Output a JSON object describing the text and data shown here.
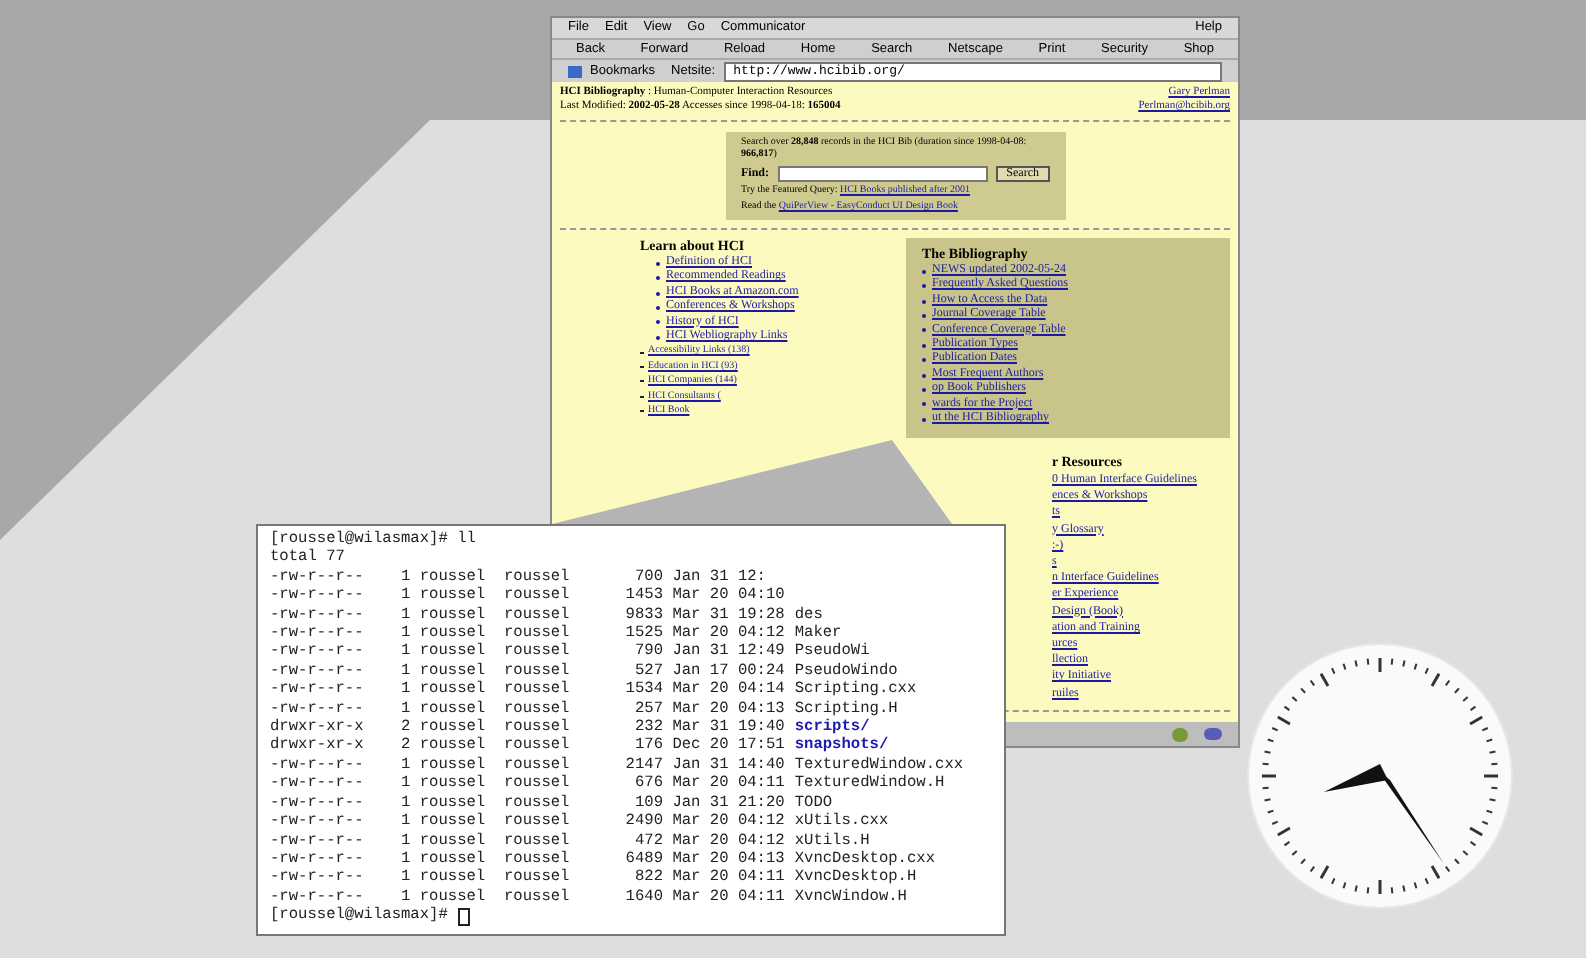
{
  "browser": {
    "menu": [
      "File",
      "Edit",
      "View",
      "Go",
      "Communicator"
    ],
    "help_menu": "Help",
    "toolbar": [
      "Back",
      "Forward",
      "Reload",
      "Home",
      "Search",
      "Netscape",
      "Print",
      "Security",
      "Shop"
    ],
    "bookmarks": "Bookmarks",
    "netsite_label": "Netsite:",
    "url": "http://www.hcibib.org/",
    "page": {
      "title": "**HCI Bibliography** : Human-Computer Interaction Resources",
      "modified": "Last Modified: **2002-05-28** Accesses since 1998-04-18: **165004**",
      "author": "Gary Perlman",
      "email": "Perlman@hcibib.org",
      "search_note": "Search over **28,848** records in the HCI Bib (duration since 1998-04-08: **966,817**)",
      "find_label": "Find:",
      "search_button": "Search",
      "featured": [
        {
          "text": "Try the Featured Query:",
          "link": "HCI Books published after 2001"
        },
        {
          "text": "Read the",
          "link": "QuiPerView - EasyConduct UI Design Book"
        }
      ],
      "learn": {
        "heading": "Learn about HCI",
        "items": [
          {
            "text": "Definition of HCI",
            "kind": "main"
          },
          {
            "text": "Recommended Readings",
            "kind": "main"
          },
          {
            "text": "HCI Books at Amazon.com",
            "kind": "main"
          },
          {
            "text": "Conferences & Workshops",
            "kind": "main"
          },
          {
            "text": "History of HCI",
            "kind": "main"
          },
          {
            "text": "HCI Webliography Links",
            "kind": "main"
          },
          {
            "text": "Accessibility Links (138)",
            "kind": "sub"
          },
          {
            "text": "Education in HCI (93)",
            "kind": "sub"
          },
          {
            "text": "HCI Companies (144)",
            "kind": "sub"
          },
          {
            "text": "HCI Consultants (",
            "kind": "sub"
          },
          {
            "text": "HCI Book",
            "kind": "sub"
          }
        ]
      },
      "bibliography": {
        "heading": "The Bibliography",
        "items": [
          "NEWS updated 2002-05-24",
          "Frequently Asked Questions",
          "How to Access the Data",
          "Journal Coverage Table",
          "Conference Coverage Table",
          "Publication Types",
          "Publication Dates",
          "Most Frequent Authors",
          "op Book Publishers",
          "wards for the Project",
          "ut the HCI Bibliography"
        ]
      },
      "resources": {
        "heading": "r Resources",
        "items": [
          "0 Human Interface Guidelines",
          "ences & Workshops",
          "ts",
          "y Glossary",
          ":-)",
          "s",
          "n Interface Guidelines",
          "er Experience",
          "Design (Book)",
          "ation and Training",
          "urces",
          "llection",
          "ity Initiative",
          "ruiles"
        ]
      }
    }
  },
  "terminal": {
    "prompt": "[roussel@wilasmax]# ll",
    "total": "total 77",
    "rows": [
      {
        "info": "-rw-r--r--    1 roussel  roussel       700 Jan 31 12:"
      },
      {
        "info": "-rw-r--r--    1 roussel  roussel      1453 Mar 20 04:10"
      },
      {
        "info": "-rw-r--r--    1 roussel  roussel      9833 Mar 31 19:28",
        "name": "des",
        "kind": "file"
      },
      {
        "info": "-rw-r--r--    1 roussel  roussel      1525 Mar 20 04:12",
        "name": "Maker",
        "kind": "file"
      },
      {
        "info": "-rw-r--r--    1 roussel  roussel       790 Jan 31 12:49",
        "name": "PseudoWi",
        "kind": "file"
      },
      {
        "info": "-rw-r--r--    1 roussel  roussel       527 Jan 17 00:24",
        "name": "PseudoWindo",
        "kind": "file"
      },
      {
        "info": "-rw-r--r--    1 roussel  roussel      1534 Mar 20 04:14",
        "name": "Scripting.cxx",
        "kind": "file"
      },
      {
        "info": "-rw-r--r--    1 roussel  roussel       257 Mar 20 04:13",
        "name": "Scripting.H",
        "kind": "file"
      },
      {
        "info": "drwxr-xr-x    2 roussel  roussel       232 Mar 31 19:40",
        "name": "scripts/",
        "kind": "dir"
      },
      {
        "info": "drwxr-xr-x    2 roussel  roussel       176 Dec 20 17:51",
        "name": "snapshots/",
        "kind": "dir"
      },
      {
        "info": "-rw-r--r--    1 roussel  roussel      2147 Jan 31 14:40",
        "name": "TexturedWindow.cxx",
        "kind": "file"
      },
      {
        "info": "-rw-r--r--    1 roussel  roussel       676 Mar 20 04:11",
        "name": "TexturedWindow.H",
        "kind": "file"
      },
      {
        "info": "-rw-r--r--    1 roussel  roussel       109 Jan 31 21:20",
        "name": "TODO",
        "kind": "file"
      },
      {
        "info": "-rw-r--r--    1 roussel  roussel      2490 Mar 20 04:12",
        "name": "xUtils.cxx",
        "kind": "file"
      },
      {
        "info": "-rw-r--r--    1 roussel  roussel       472 Mar 20 04:12",
        "name": "xUtils.H",
        "kind": "file"
      },
      {
        "info": "-rw-r--r--    1 roussel  roussel      6489 Mar 20 04:13",
        "name": "XvncDesktop.cxx",
        "kind": "file"
      },
      {
        "info": "-rw-r--r--    1 roussel  roussel       822 Mar 20 04:11",
        "name": "XvncDesktop.H",
        "kind": "file"
      },
      {
        "info": "-rw-r--r--    1 roussel  roussel      1640 Mar 20 04:11",
        "name": "XvncWindow.H",
        "kind": "file"
      }
    ],
    "prompt_end": "[roussel@wilasmax]# "
  }
}
